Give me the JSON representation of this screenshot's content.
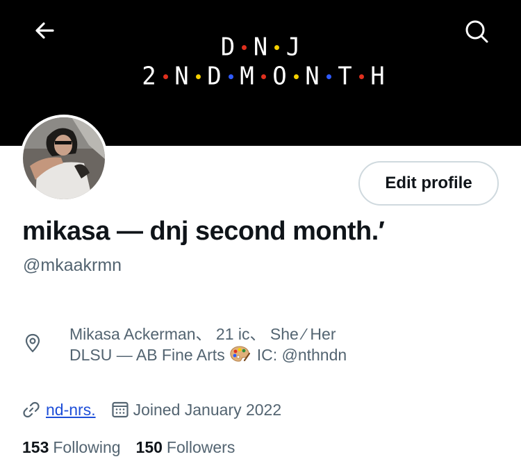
{
  "header": {
    "banner_line1": [
      {
        "char": "D",
        "dot_after": "#e0301e"
      },
      {
        "char": "N",
        "dot_after": "#f5d000"
      },
      {
        "char": "J",
        "dot_after": null
      }
    ],
    "banner_line2": [
      {
        "char": "2",
        "dot_after": "#e0301e"
      },
      {
        "char": "N",
        "dot_after": "#f5d000"
      },
      {
        "char": "D",
        "dot_after": "#2f5bff"
      },
      {
        "char": "M",
        "dot_after": "#e0301e"
      },
      {
        "char": "O",
        "dot_after": "#f5d000"
      },
      {
        "char": "N",
        "dot_after": "#2f5bff"
      },
      {
        "char": "T",
        "dot_after": "#e0301e"
      },
      {
        "char": "H",
        "dot_after": null
      }
    ],
    "back_icon": "back-arrow-icon",
    "search_icon": "search-icon"
  },
  "profile": {
    "edit_label": "Edit profile",
    "display_name": "mikasa — dnj second month.′",
    "handle": "@mkaakrmn",
    "bio_line1": "Mikasa  Ackerman、 21 ic、 She  ⁄  Her",
    "bio_line2_pre": "DLSU — AB Fine Arts",
    "bio_line2_post": "IC: @nthndn",
    "website": "nd-nrs.",
    "joined": "Joined January 2022",
    "following_count": "153",
    "following_label": "Following",
    "followers_count": "150",
    "followers_label": "Followers"
  },
  "colors": {
    "accent_link": "#1d4ed8",
    "muted_text": "#536471",
    "banner_bg": "#000000"
  }
}
